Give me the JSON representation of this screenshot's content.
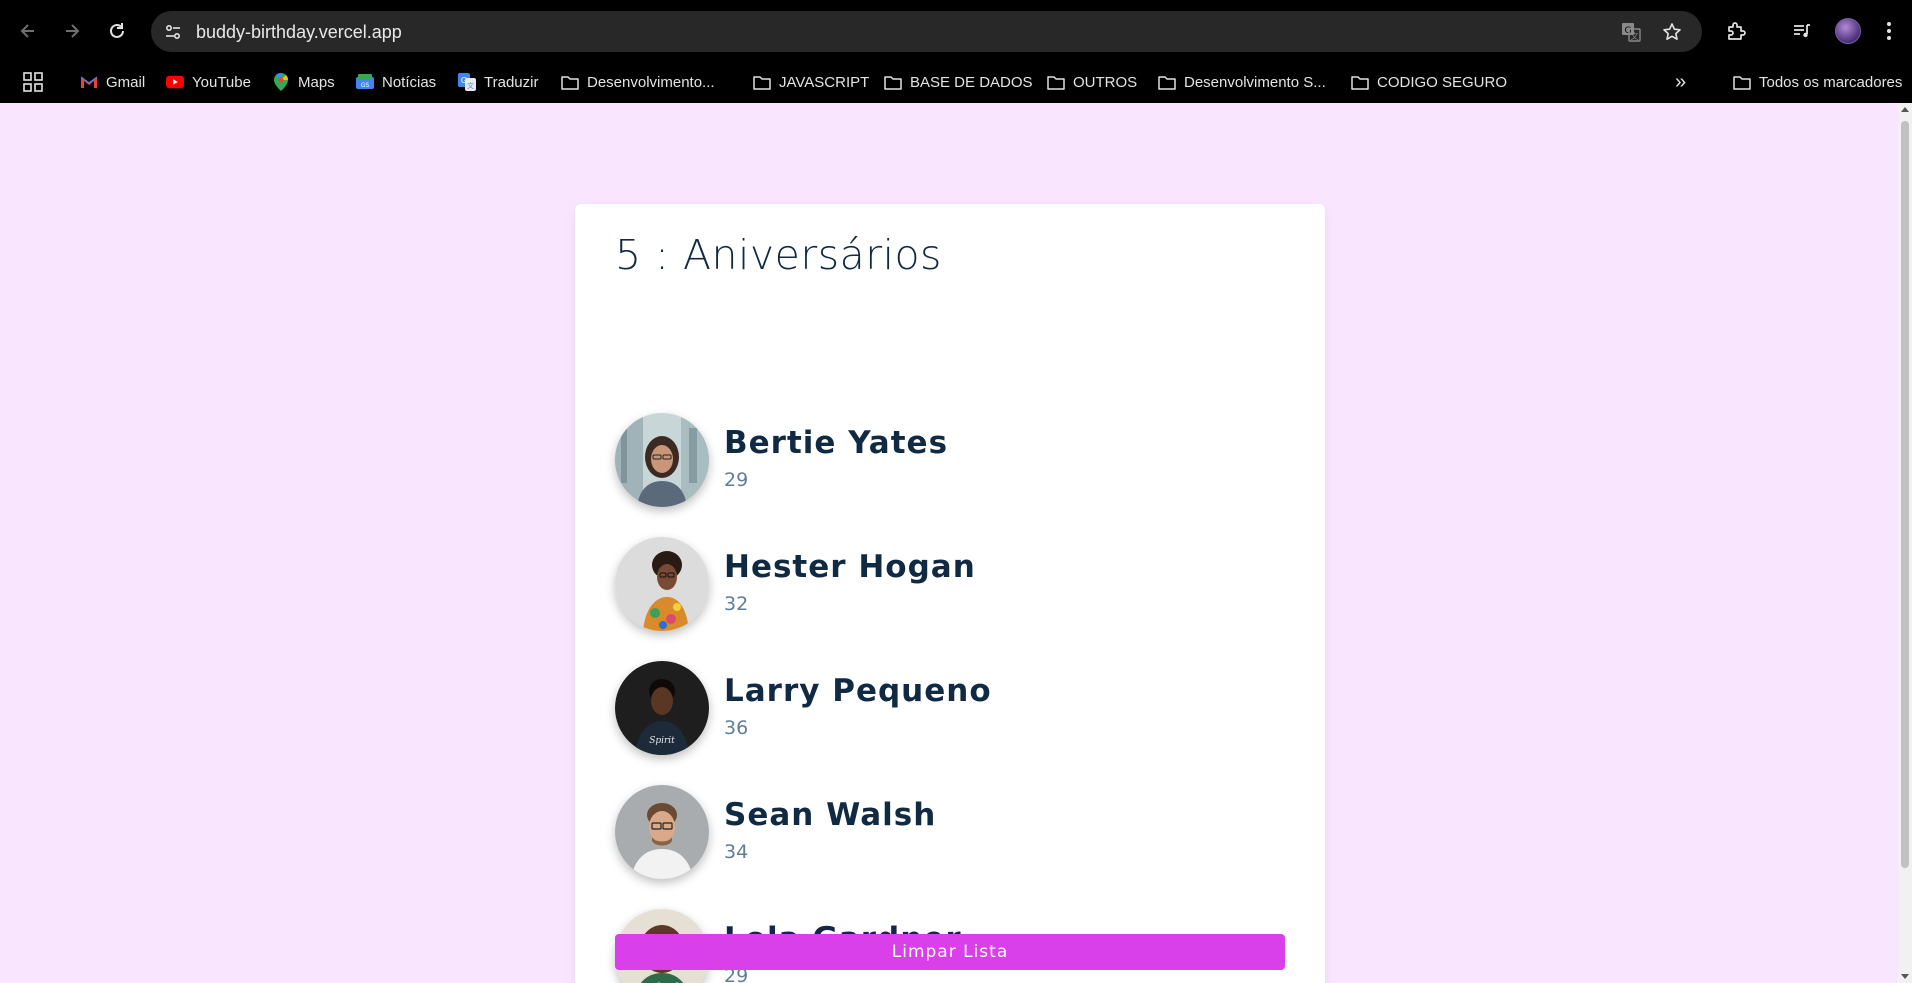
{
  "browser": {
    "url": "buddy-birthday.vercel.app",
    "bookmarks": [
      {
        "label": "Gmail",
        "icon": "gmail-icon"
      },
      {
        "label": "YouTube",
        "icon": "youtube-icon"
      },
      {
        "label": "Maps",
        "icon": "maps-icon"
      },
      {
        "label": "Notícias",
        "icon": "news-icon"
      },
      {
        "label": "Traduzir",
        "icon": "translate-icon"
      },
      {
        "label": "Desenvolvimento...",
        "icon": "folder-icon"
      },
      {
        "label": "JAVASCRIPT",
        "icon": "folder-icon"
      },
      {
        "label": "BASE DE DADOS",
        "icon": "folder-icon"
      },
      {
        "label": "OUTROS",
        "icon": "folder-icon"
      },
      {
        "label": "Desenvolvimento S...",
        "icon": "folder-icon"
      },
      {
        "label": "CODIGO SEGURO",
        "icon": "folder-icon"
      }
    ],
    "all_bookmarks_label": "Todos os marcadores",
    "overflow_label": "»"
  },
  "app": {
    "title": "5 : Aniversários",
    "people": [
      {
        "name": "Bertie Yates",
        "age": "29"
      },
      {
        "name": "Hester Hogan",
        "age": "32"
      },
      {
        "name": "Larry Pequeno",
        "age": "36"
      },
      {
        "name": "Sean Walsh",
        "age": "34"
      },
      {
        "name": "Lola Gardner",
        "age": "29"
      }
    ],
    "clear_button": "Limpar Lista"
  },
  "colors": {
    "page_background": "#f9e5fd",
    "accent": "#da40ea",
    "name_text": "#102a43",
    "age_text": "#617d98"
  }
}
